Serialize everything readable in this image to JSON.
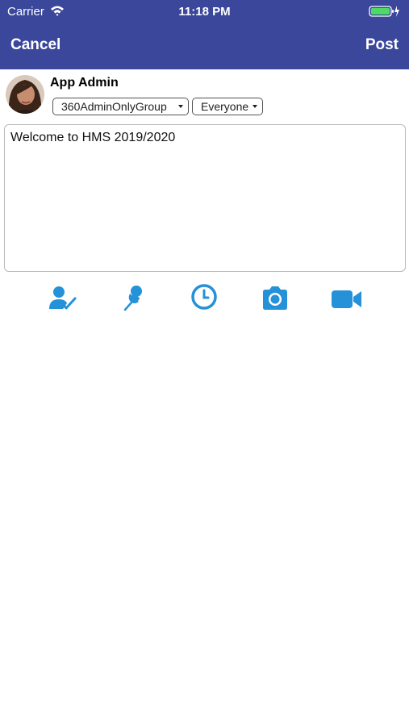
{
  "status_bar": {
    "carrier": "Carrier",
    "time": "11:18 PM"
  },
  "nav": {
    "cancel_label": "Cancel",
    "post_label": "Post"
  },
  "author": {
    "name": "App Admin"
  },
  "group_selector": {
    "selected": "360AdminOnlyGroup"
  },
  "audience_selector": {
    "selected": "Everyone"
  },
  "post_body": {
    "value": "Welcome to HMS 2019/2020"
  },
  "toolbar": {
    "icons": [
      "tag-user-icon",
      "pin-icon",
      "schedule-clock-icon",
      "camera-icon",
      "video-icon"
    ]
  },
  "colors": {
    "header_bg": "#3a479b",
    "accent_icon": "#2591d9",
    "battery_green": "#4cd964"
  }
}
